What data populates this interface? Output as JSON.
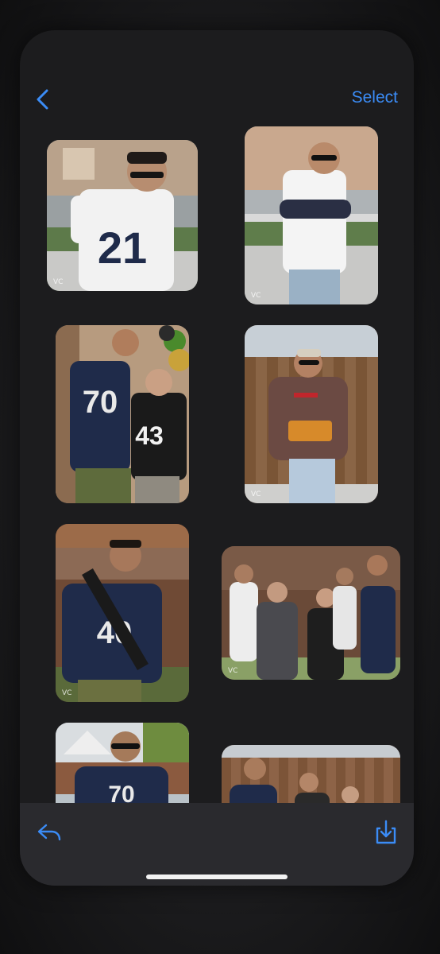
{
  "nav": {
    "back_icon": "chevron-left-icon",
    "select_label": "Select",
    "accent": "#3b8cf6"
  },
  "photos": [
    {
      "name": "photo-man-21-jersey-sunglasses",
      "watermark": "VC"
    },
    {
      "name": "photo-man-21-jersey-arms-crossed",
      "watermark": "VC"
    },
    {
      "name": "photo-couple-70-43-jerseys",
      "watermark": ""
    },
    {
      "name": "photo-man-holding-snacks",
      "watermark": "VC"
    },
    {
      "name": "photo-man-dad-to-be-sash",
      "watermark": "VC"
    },
    {
      "name": "photo-group-party",
      "watermark": "VC"
    },
    {
      "name": "photo-man-dad-to-be-gazebo",
      "watermark": ""
    },
    {
      "name": "photo-group-fence",
      "watermark": ""
    }
  ],
  "toolbar": {
    "reply_icon": "reply-arrow-icon",
    "save_icon": "download-icon"
  }
}
